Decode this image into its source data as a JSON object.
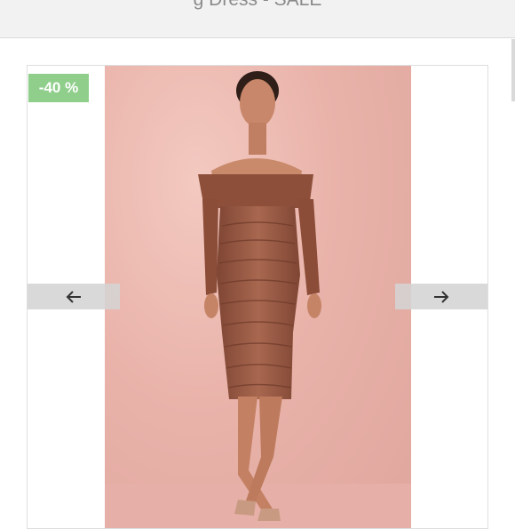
{
  "header": {
    "title": "g Dress - SALE"
  },
  "gallery": {
    "discount_badge": "-40 %",
    "image_alt": "Model in off-shoulder ruched mesh midi dress",
    "prev_icon": "arrow-left-icon",
    "next_icon": "arrow-right-icon"
  },
  "colors": {
    "badge_bg": "#8fce8b",
    "dress": "#9a5a44",
    "backdrop": "#e9b3aa"
  }
}
